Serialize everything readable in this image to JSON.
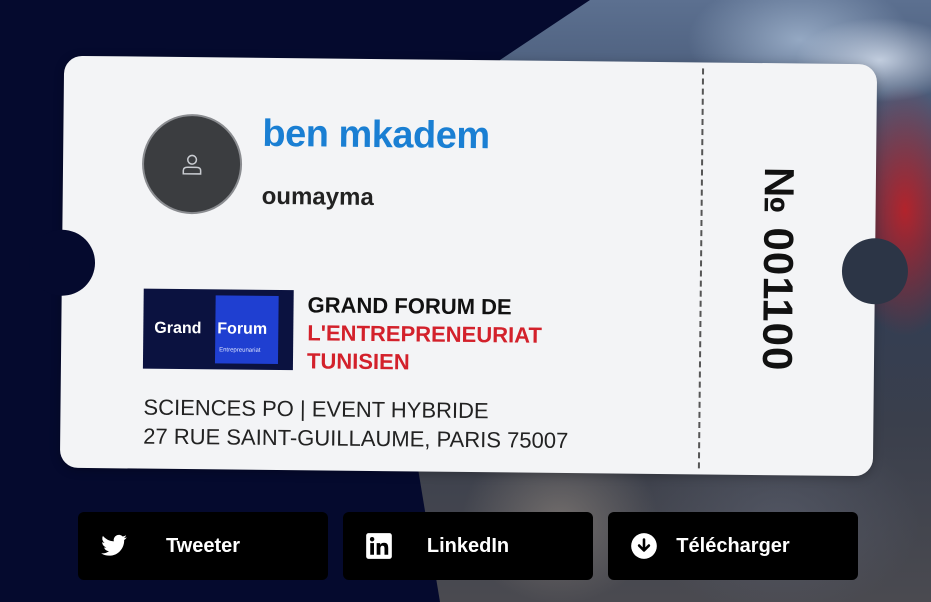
{
  "ticket": {
    "last_name": "ben mkadem",
    "first_name": "oumayma",
    "logo": {
      "word1": "Grand",
      "word2": "Forum",
      "word3": "Entrepreunariat"
    },
    "event_title": {
      "line1": "GRAND FORUM DE",
      "line2": "L'ENTREPRENEURIAT",
      "line3": "TUNISIEN"
    },
    "venue": {
      "line1": "SCIENCES PO | EVENT HYBRIDE",
      "line2": "27 RUE SAINT-GUILLAUME, PARIS 75007"
    },
    "number": "№ 001100"
  },
  "actions": {
    "tweet_label": "Tweeter",
    "linkedin_label": "LinkedIn",
    "download_label": "Télécharger"
  },
  "icons": {
    "avatar": "user-icon",
    "tweet": "twitter-icon",
    "linkedin": "linkedin-icon",
    "download": "download-icon"
  },
  "colors": {
    "background": "#050a2e",
    "name": "#1a7fd3",
    "accent_red": "#d3212b",
    "ticket": "#f3f4f6",
    "button": "#000000"
  }
}
